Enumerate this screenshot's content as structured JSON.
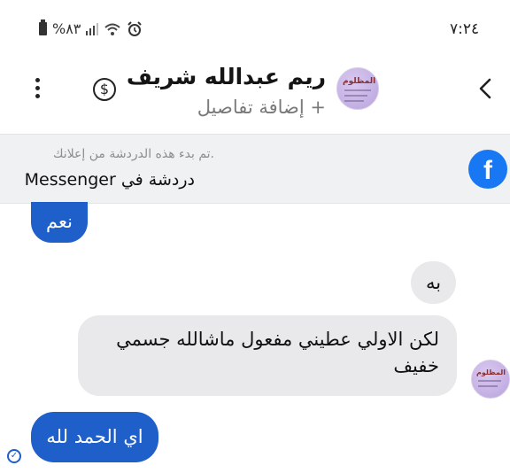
{
  "status_bar": {
    "time": "٧:٢٤",
    "battery_text": "%٨٣",
    "icons": [
      "battery-icon",
      "signal-icon",
      "wifi-icon",
      "alarm-icon"
    ]
  },
  "header": {
    "contact_name": "ريم عبدالله شريف",
    "add_details": "+ إضافة تفاصيل",
    "avatar_text": "المظلوم",
    "icons": [
      "back-chevron-icon",
      "dollar-icon",
      "more-vertical-icon"
    ]
  },
  "ad_banner": {
    "subtitle": ".تم بدء هذه الدردشة من إعلانك",
    "title": "دردشة في Messenger",
    "icon": "facebook-icon",
    "icon_color": "#1877f2"
  },
  "messages": [
    {
      "direction": "outgoing",
      "text": "نعم"
    },
    {
      "direction": "incoming",
      "text": "به"
    },
    {
      "direction": "incoming",
      "text": "لكن الاولي عطيني مفعول ماشالله جسمي خفيف"
    },
    {
      "direction": "outgoing",
      "text": "اي الحمد لله"
    }
  ],
  "colors": {
    "outgoing_bubble": "#1f5fc9",
    "incoming_bubble": "#e9e9eb",
    "banner_bg": "#f0f1f3"
  }
}
